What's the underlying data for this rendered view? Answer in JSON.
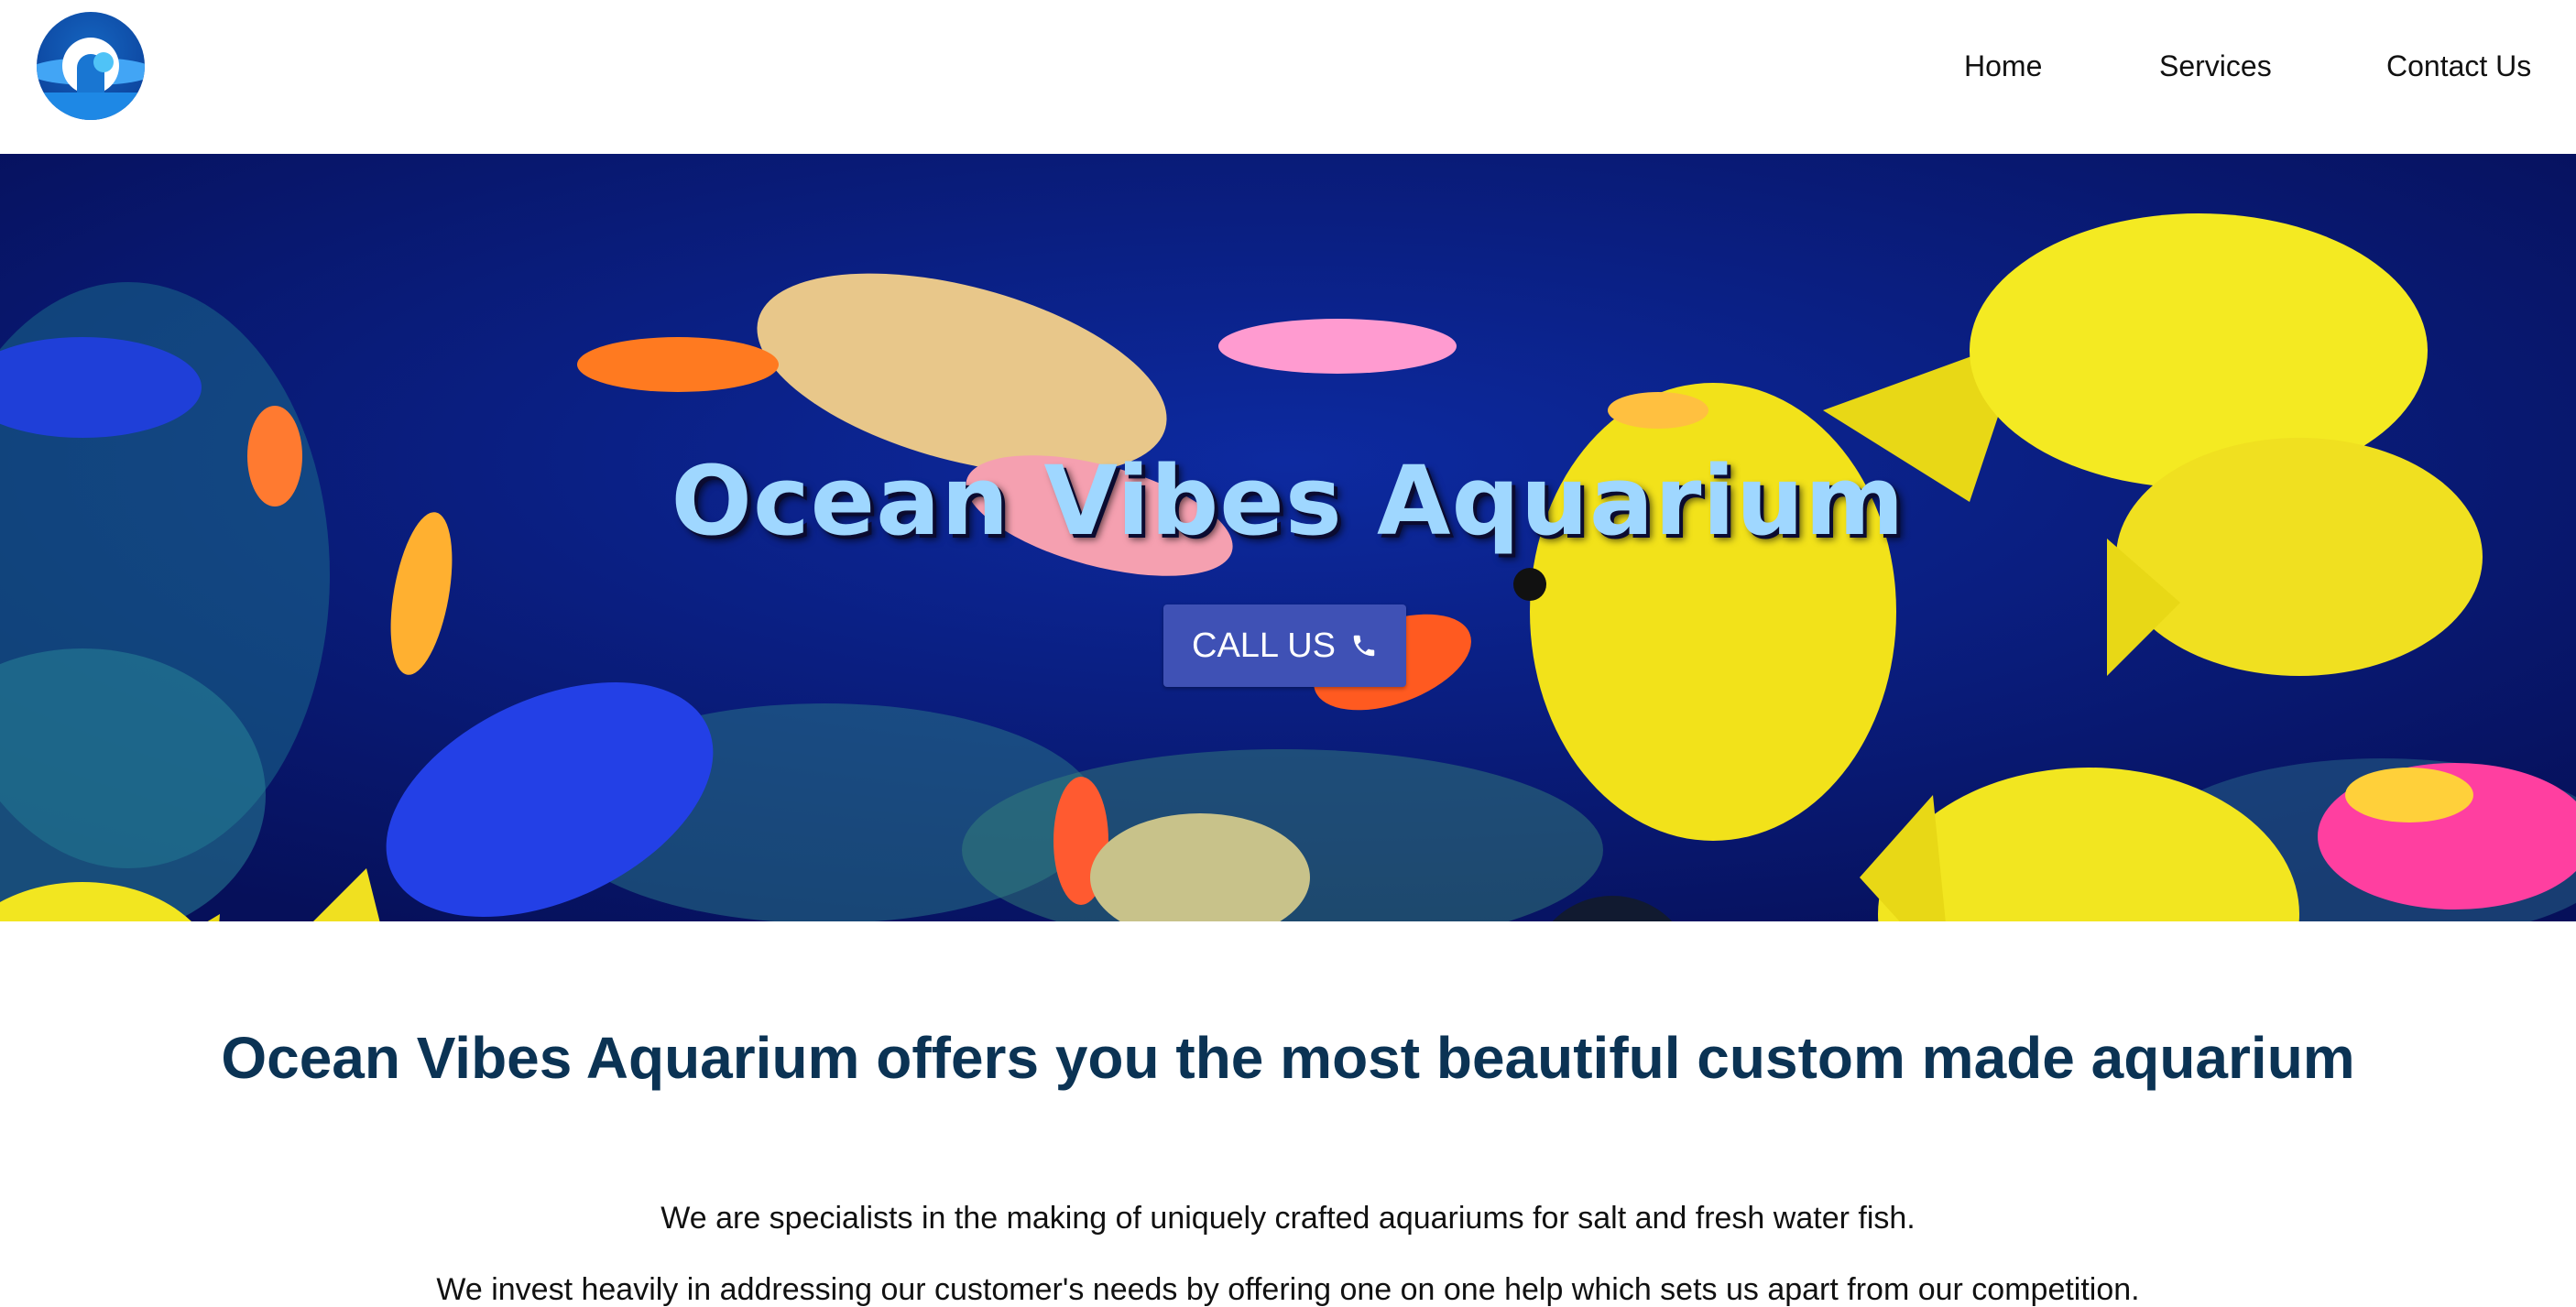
{
  "header": {
    "logo_name": "ocean-vibes-logo",
    "nav": [
      {
        "label": "Home"
      },
      {
        "label": "Services"
      },
      {
        "label": "Contact Us"
      }
    ]
  },
  "hero": {
    "title": "Ocean Vibes Aquarium",
    "cta_label": "CALL US",
    "cta_icon": "phone-icon",
    "colors": {
      "title": "#9fd7ff",
      "button": "#3f51b5",
      "background": "#0b1f8f"
    }
  },
  "content": {
    "headline": "Ocean Vibes Aquarium offers you the most beautiful custom made aquarium",
    "paragraphs": [
      "We are specialists in the making of uniquely crafted aquariums for salt and fresh water fish.",
      "We invest heavily in addressing our customer's needs by offering one on one help which sets us apart from our competition."
    ],
    "colors": {
      "headline": "#0b3354"
    }
  }
}
